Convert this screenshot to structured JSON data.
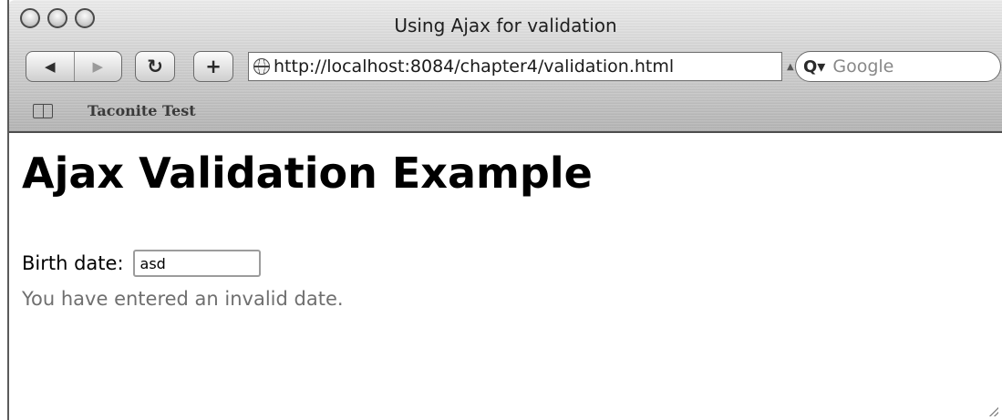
{
  "window": {
    "title": "Using Ajax for validation"
  },
  "toolbar": {
    "back_glyph": "◀",
    "forward_glyph": "▶",
    "reload_glyph": "↻",
    "add_glyph": "+",
    "url": "http://localhost:8084/chapter4/validation.html",
    "search_placeholder": "Google"
  },
  "bookmarks_bar": {
    "items": [
      {
        "label": "Taconite Test"
      }
    ]
  },
  "page": {
    "heading": "Ajax Validation Example",
    "birth_date_label": "Birth date:",
    "birth_date_value": "asd",
    "error_message": "You have entered an invalid date."
  },
  "icons": {
    "traffic_lights": [
      "close-icon",
      "minimize-icon",
      "zoom-icon"
    ],
    "url_site_icon": "globe-icon",
    "search_icon": "magnifier-icon",
    "bookmarks_icon": "book-icon"
  }
}
